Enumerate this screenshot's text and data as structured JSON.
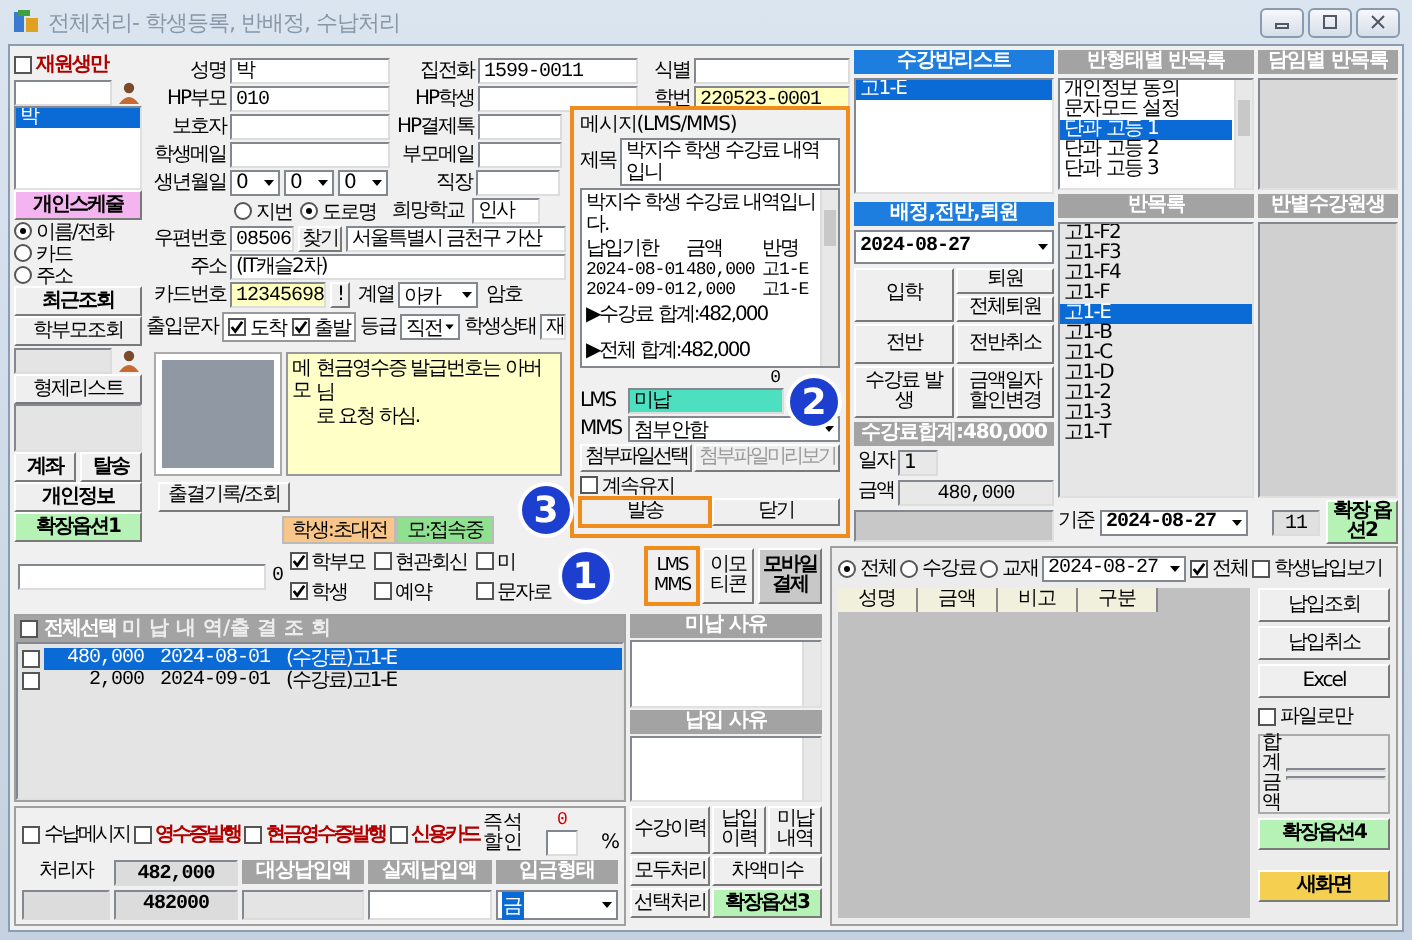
{
  "window": {
    "title": "전체처리- 학생등록, 반배정, 수납처리"
  },
  "sidebar": {
    "active_only": {
      "label": "재원생만",
      "checked": false
    },
    "results": [
      {
        "name": "박",
        "selected": true
      }
    ],
    "schedule_button": "개인스케줄",
    "search_modes": [
      {
        "label": "이름/전화",
        "selected": true
      },
      {
        "label": "카드",
        "selected": false
      },
      {
        "label": "주소",
        "selected": false
      }
    ],
    "recent_button": "최근조회",
    "parent_search_button": "학부모조회",
    "sibling_button": "형제리스트",
    "account_button": "계좌",
    "leave_button": "탈송",
    "info_button": "개인정보",
    "ext_button": "확장옵션1"
  },
  "student": {
    "name": {
      "label": "성명",
      "value": "박"
    },
    "home_phone": {
      "label": "집전화",
      "value": "1599-0011"
    },
    "tag": {
      "label": "식별"
    },
    "parent_hp": {
      "label": "HP부모",
      "value": "010"
    },
    "student_hp": {
      "label": "HP학생"
    },
    "student_no": {
      "label": "학번",
      "value": "220523-0001"
    },
    "guardian": {
      "label": "보호자"
    },
    "pay_talk": {
      "label": "HP결제톡"
    },
    "student_mail": {
      "label": "학생메일"
    },
    "parent_mail": {
      "label": "부모메일"
    },
    "birth": {
      "label": "생년월일",
      "parts": [
        "0",
        "0",
        "0"
      ]
    },
    "work": {
      "label": "직장"
    },
    "address_modes": [
      {
        "label": "지번",
        "selected": false
      },
      {
        "label": "도로명",
        "selected": true
      }
    ],
    "school": {
      "label": "희망학교",
      "value": "인사"
    },
    "zip": {
      "label": "우편번호",
      "value": "08506",
      "button": "찾기",
      "address1": "서울특별시 금천구 가산"
    },
    "address": {
      "label": "주소",
      "value": "(IT캐슬2차)"
    },
    "card": {
      "label": "카드번호",
      "value": "12345698",
      "button": "!"
    },
    "track": {
      "label": "계열",
      "value": "아카"
    },
    "password": {
      "label": "암호"
    },
    "entry_sms": {
      "label": "출입문자",
      "options": [
        {
          "label": "도착",
          "checked": true
        },
        {
          "label": "출발",
          "checked": true
        }
      ]
    },
    "grade": {
      "label": "등급",
      "value": "직전"
    },
    "status": {
      "label": "학생상태",
      "value": "재"
    },
    "memo": {
      "label": "메모",
      "value": "현금영수증 발급번호는 아버님\n로 요청 하심."
    },
    "attendance_button": "출결기록/조회",
    "badges": [
      {
        "label": "학생:초대전",
        "color": "#f8c58a"
      },
      {
        "label": "모:접속중",
        "color": "#8fe08f"
      }
    ]
  },
  "message_popup": {
    "title": "메시지(LMS/MMS)",
    "subject_label": "제목",
    "subject": "박지수 학생 수강료 내역입니",
    "greeting": "박지수 학생 수강료 내역입니다.",
    "table": {
      "columns": [
        "납입기한",
        "금액",
        "반명"
      ],
      "rows": [
        [
          "2024-08-01",
          "480,000",
          "고1-E"
        ],
        [
          "2024-09-01",
          "2,000",
          "고1-E"
        ]
      ]
    },
    "fee_sum": "▶수강료 합계:482,000",
    "grand_sum": "▶전체 합계:482,000",
    "count": "0",
    "lms": {
      "label": "LMS",
      "value": "미납"
    },
    "mms": {
      "label": "MMS",
      "value": "첨부안함"
    },
    "attach_button": "첨부파일선택",
    "preview_button": {
      "label": "첨부파일미리보기",
      "disabled": true
    },
    "keep": {
      "label": "계속유지",
      "checked": false
    },
    "send_button": {
      "label": "발송",
      "highlighted": true
    },
    "close_button": "닫기"
  },
  "annotations": [
    "1",
    "2",
    "3"
  ],
  "class_list": {
    "title": "수강반리스트",
    "items": [
      {
        "label": "고1-E",
        "selected": true
      }
    ]
  },
  "assignment": {
    "title": "배정,전반,퇴원",
    "date": "2024-08-27",
    "buttons": [
      "입학",
      "전반",
      "수강료 발생",
      "퇴원",
      "전체퇴원",
      "전반취소",
      "금액일자 할인변경"
    ]
  },
  "fee_total": {
    "title": "수강료합계:480,000",
    "date_label": "일자",
    "date": "1",
    "amount_label": "금액",
    "amount": "480,000"
  },
  "class_groups": {
    "title": "반형태별 반목록",
    "items": [
      {
        "label": "개인정보 동의",
        "selected": false
      },
      {
        "label": "문자모드 설정",
        "selected": false
      },
      {
        "label": "단과 고등 1",
        "selected": true
      },
      {
        "label": "단과 고등 2",
        "selected": false
      },
      {
        "label": "단과 고등 3",
        "selected": false
      }
    ]
  },
  "homeroom": {
    "title": "담임별 반목록"
  },
  "classes": {
    "title": "반목록",
    "items": [
      {
        "label": "고1-F2",
        "selected": false
      },
      {
        "label": "고1-F3",
        "selected": false
      },
      {
        "label": "고1-F4",
        "selected": false
      },
      {
        "label": "고1-F",
        "selected": false
      },
      {
        "label": "고1-E",
        "selected": true
      },
      {
        "label": "고1-B",
        "selected": false
      },
      {
        "label": "고1-C",
        "selected": false
      },
      {
        "label": "고1-D",
        "selected": false
      },
      {
        "label": "고1-2",
        "selected": false
      },
      {
        "label": "고1-3",
        "selected": false
      },
      {
        "label": "고1-T",
        "selected": false
      }
    ]
  },
  "class_students": {
    "title": "반별수강원생"
  },
  "base": {
    "label": "기준",
    "date": "2024-08-27",
    "count": "11",
    "ext_button": "확장 옵션2"
  },
  "sms_bar": {
    "count": "0",
    "targets": [
      {
        "label": "학부모",
        "checked": true
      },
      {
        "label": "현관회신",
        "checked": false
      },
      {
        "label": "미",
        "checked": false
      },
      {
        "label": "학생",
        "checked": true
      },
      {
        "label": "예약",
        "checked": false
      },
      {
        "label": "문자로",
        "checked": false
      }
    ],
    "buttons": [
      {
        "label": "LMS MMS",
        "kind": "lms",
        "highlighted": true
      },
      {
        "label": "이모티콘",
        "kind": "plain",
        "highlighted": false
      },
      {
        "label": "모바일결제",
        "kind": "mobile",
        "highlighted": false
      }
    ]
  },
  "unpaid": {
    "select_all": {
      "label": "전체선택",
      "checked": false
    },
    "title": "미 납 내 역/출 결 조 회",
    "rows": [
      {
        "checked": false,
        "selected": true,
        "amount": "480,000",
        "date": "2024-08-01",
        "item": "(수강료)고1-E"
      },
      {
        "checked": false,
        "selected": false,
        "amount": "2,000",
        "date": "2024-09-01",
        "item": "(수강료)고1-E"
      }
    ]
  },
  "reasons": [
    {
      "title": "미납 사유"
    },
    {
      "title": "납입 사유"
    }
  ],
  "actions": [
    {
      "label": "수강이력",
      "kind": "plain"
    },
    {
      "label": "납입이력",
      "kind": "plain"
    },
    {
      "label": "미납내역",
      "kind": "plain"
    },
    {
      "label": "모두처리",
      "kind": "plain"
    },
    {
      "label": "차액미수",
      "kind": "plain"
    },
    {
      "label": "선택처리",
      "kind": "plain"
    },
    {
      "label": "확장옵션3",
      "kind": "ext"
    }
  ],
  "payments": {
    "filters": [
      {
        "label": "전체",
        "selected": true
      },
      {
        "label": "수강료",
        "selected": false
      },
      {
        "label": "교재",
        "selected": false
      }
    ],
    "date": "2024-08-27",
    "all": {
      "label": "전체",
      "checked": true
    },
    "student_view": {
      "label": "학생납입보기",
      "checked": false
    },
    "columns": [
      "성명",
      "금액",
      "비고",
      "구분"
    ],
    "buttons": [
      "납입조회",
      "납입취소",
      "Excel"
    ],
    "file_only": {
      "label": "파일로만",
      "checked": false
    },
    "sum_label": "합계금액",
    "ext_button": "확장옵션4",
    "new_button": "새화면"
  },
  "checkout": {
    "options": [
      {
        "label": "수납메시지",
        "checked": false,
        "kind": "plain"
      },
      {
        "label": "영수증발행",
        "checked": false,
        "kind": "alert"
      },
      {
        "label": "현금영수증발행",
        "checked": false,
        "kind": "alert"
      },
      {
        "label": "신용카드",
        "checked": false,
        "kind": "alert"
      }
    ],
    "discount_label": "즉석할인",
    "discount_reading": "0",
    "percent": "%",
    "handler_label": "처리자",
    "total": "482,000",
    "total_raw": "482000",
    "columns": [
      "대상납입액",
      "실제납입액",
      "입금형태"
    ],
    "pay_type": "금"
  }
}
